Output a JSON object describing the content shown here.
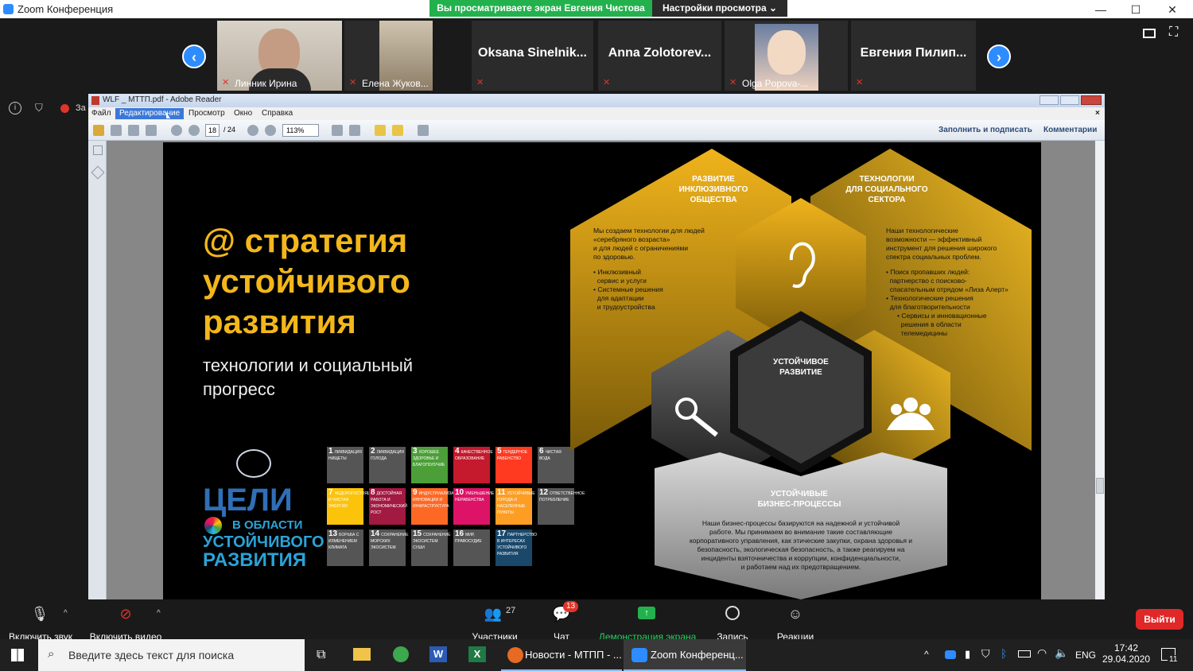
{
  "window": {
    "title": "Zoom Конференция",
    "min": "—",
    "max": "☐",
    "close": "✕"
  },
  "share_banner": {
    "viewing": "Вы просматриваете экран Евгения Чистова",
    "view_settings": "Настройки просмотра ⌄"
  },
  "participants": [
    {
      "name": "Линник Ирина",
      "video": true
    },
    {
      "name": "Елена Жуков...",
      "video": true
    },
    {
      "name": "Oksana Sinelnik...",
      "video": false
    },
    {
      "name": "Anna Zolotorev...",
      "video": false
    },
    {
      "name": "Olga Popova-...",
      "video": true
    },
    {
      "name": "Евгения Пилип...",
      "video": false
    }
  ],
  "rec_label": "За",
  "reader": {
    "title": "WLF _ МТТП.pdf - Adobe Reader",
    "menu": [
      "Файл",
      "Редактирование",
      "Просмотр",
      "Окно",
      "Справка"
    ],
    "page_current": "18",
    "page_total": "/ 24",
    "zoom": "113%",
    "fill_sign": "Заполнить и подписать",
    "comments": "Комментарии",
    "close_doc": "×"
  },
  "slide": {
    "title_lines": [
      "@ стратегия",
      "устойчивого",
      "развития"
    ],
    "subtitle_lines": [
      "технологии и социальный",
      "прогресс"
    ],
    "sdg_logo": [
      "ЦЕЛИ",
      "В ОБЛАСТИ",
      "УСТОЙЧИВОГО",
      "РАЗВИТИЯ"
    ],
    "sdg_tiles": [
      {
        "n": "1",
        "t": "ЛИКВИДАЦИЯ НИЩЕТЫ",
        "c": "#555555"
      },
      {
        "n": "2",
        "t": "ЛИКВИДАЦИЯ ГОЛОДА",
        "c": "#555555"
      },
      {
        "n": "3",
        "t": "ХОРОШЕЕ ЗДОРОВЬЕ И БЛАГОПОЛУЧИЕ",
        "c": "#4c9f38"
      },
      {
        "n": "4",
        "t": "КАЧЕСТВЕННОЕ ОБРАЗОВАНИЕ",
        "c": "#c5192d"
      },
      {
        "n": "5",
        "t": "ГЕНДЕРНОЕ РАВЕНСТВО",
        "c": "#ff3a21"
      },
      {
        "n": "6",
        "t": "ЧИСТАЯ ВОДА",
        "c": "#555555"
      },
      {
        "n": "7",
        "t": "НЕДОРОГОСТОЯЩАЯ И ЧИСТАЯ ЭНЕРГИЯ",
        "c": "#fcc30b"
      },
      {
        "n": "8",
        "t": "ДОСТОЙНАЯ РАБОТА И ЭКОНОМИЧЕСКИЙ РОСТ",
        "c": "#a21942"
      },
      {
        "n": "9",
        "t": "ИНДУСТРИАЛИЗАЦИЯ, ИННОВАЦИИ И ИНФРАСТРУКТУРА",
        "c": "#fd6925"
      },
      {
        "n": "10",
        "t": "УМЕНЬШЕНИЕ НЕРАВЕНСТВА",
        "c": "#dd1367"
      },
      {
        "n": "11",
        "t": "УСТОЙЧИВЫЕ ГОРОДА И НАСЕЛЕННЫЕ ПУНКТЫ",
        "c": "#fd9d24"
      },
      {
        "n": "12",
        "t": "ОТВЕТСТВЕННОЕ ПОТРЕБЛЕНИЕ",
        "c": "#555555"
      },
      {
        "n": "13",
        "t": "БОРЬБА С ИЗМЕНЕНИЕМ КЛИМАТА",
        "c": "#555555"
      },
      {
        "n": "14",
        "t": "СОХРАНЕНИЕ МОРСКИХ ЭКОСИСТЕМ",
        "c": "#555555"
      },
      {
        "n": "15",
        "t": "СОХРАНЕНИЕ ЭКОСИСТЕМ СУШИ",
        "c": "#555555"
      },
      {
        "n": "16",
        "t": "МИР, ПРАВОСУДИЕ",
        "c": "#555555"
      },
      {
        "n": "17",
        "t": "ПАРТНЕРСТВО В ИНТЕРЕСАХ УСТОЙЧИВОГО РАЗВИТИЯ",
        "c": "#19486a"
      }
    ],
    "hex_top_left": {
      "title": [
        "РАЗВИТИЕ",
        "ИНКЛЮЗИВНОГО",
        "ОБЩЕСТВА"
      ],
      "text": [
        "Мы создаем технологии для людей",
        "«серебряного возраста»",
        "и для людей с ограничениями",
        "по здоровью."
      ],
      "bullets": [
        "• Инклюзивный",
        "  сервис и услуги",
        "• Системные решения",
        "  для адаптации",
        "  и трудоустройства"
      ]
    },
    "hex_top_right": {
      "title": [
        "ТЕХНОЛОГИИ",
        "ДЛЯ СОЦИАЛЬНОГО",
        "СЕКТОРА"
      ],
      "text": [
        "Наши технологические",
        "возможности — эффективный",
        "инструмент для решения широкого",
        "спектра социальных проблем."
      ],
      "bullets": [
        "• Поиск пропавших людей:",
        "  партнерство с поисково-",
        "  спасательным отрядом «Лиза Алерт»",
        "• Технологические решения",
        "  для благотворительности",
        "• Сервисы и инновационные",
        "  решения в области",
        "  телемедицины"
      ]
    },
    "hex_center": [
      "УСТОЙЧИВОЕ",
      "РАЗВИТИЕ"
    ],
    "hex_bottom": {
      "title": [
        "УСТОЙЧИВЫЕ",
        "БИЗНЕС-ПРОЦЕССЫ"
      ],
      "text": [
        "Наши бизнес-процессы базируются на надежной и устойчивой",
        "работе. Мы принимаем во внимание такие составляющие",
        "корпоративного управления, как этические закупки, охрана здоровья и",
        "безопасность, экологическая безопасность, а также реагируем на",
        "инциденты взяточничества и коррупции, конфиденциальности,",
        "и работаем над их предотвращением."
      ]
    }
  },
  "controls": {
    "mute": "Включить звук",
    "video": "Включить видео",
    "participants": "Участники",
    "participants_count": "27",
    "chat": "Чат",
    "chat_badge": "13",
    "share": "Демонстрация экрана",
    "record": "Запись",
    "reactions": "Реакции",
    "leave": "Выйти"
  },
  "taskbar": {
    "search_placeholder": "Введите здесь текст для поиска",
    "app_browser": "Новости - МТПП - ...",
    "app_zoom": "Zoom Конференц...",
    "lang": "ENG",
    "time": "17:42",
    "date": "29.04.2020",
    "notif": "11"
  },
  "colors": {
    "accent": "#2d8cff",
    "gold": "#f3b71a",
    "green": "#23b14d",
    "leave": "#e02828"
  }
}
